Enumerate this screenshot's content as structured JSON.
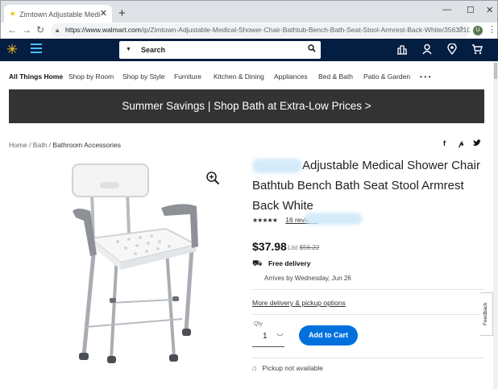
{
  "browser": {
    "tab_title": "Zimtown Adjustable Medical Sh",
    "url_host": "https://www.walmart.com",
    "url_path": "/ip/Zimtown-Adjustable-Medical-Shower-Chair-Bathtub-Bench-Bath-Seat-Stool-Armrest-Back-White/3563710...",
    "profile_initial": "U"
  },
  "header": {
    "search_label": "Search"
  },
  "categories": {
    "all": "All Things Home",
    "items": [
      "Shop by Room",
      "Shop by Style",
      "Furniture",
      "Kitchen & Dining",
      "Appliances",
      "Bed & Bath",
      "Patio & Garden"
    ],
    "more": "• • •"
  },
  "banner": {
    "text": "Summer Savings | Shop Bath at Extra-Low Prices >"
  },
  "breadcrumb": {
    "home": "Home",
    "bath": "Bath",
    "current": "Bathroom Accessories"
  },
  "product": {
    "title": "Adjustable Medical Shower Chair Bathtub Bench Bath Seat Stool Armrest Back White",
    "rating_stars": "★★★★★",
    "rating": 4,
    "reviews": "16 reviews",
    "price": "$37.98",
    "list_label": "List",
    "list_price": "$56.22",
    "shipping": "Free delivery",
    "arrives": "Arrives by Wednesday, Jun 26",
    "more_options": "More delivery & pickup options",
    "qty_label": "Qty",
    "qty_value": "1",
    "add_to_cart": "Add to Cart",
    "pickup": "Pickup not available"
  },
  "feedback": {
    "label": "Feedback"
  },
  "colors": {
    "walmart_navy": "#041e42",
    "spark_yellow": "#ffc220",
    "action_blue": "#0071dc"
  }
}
